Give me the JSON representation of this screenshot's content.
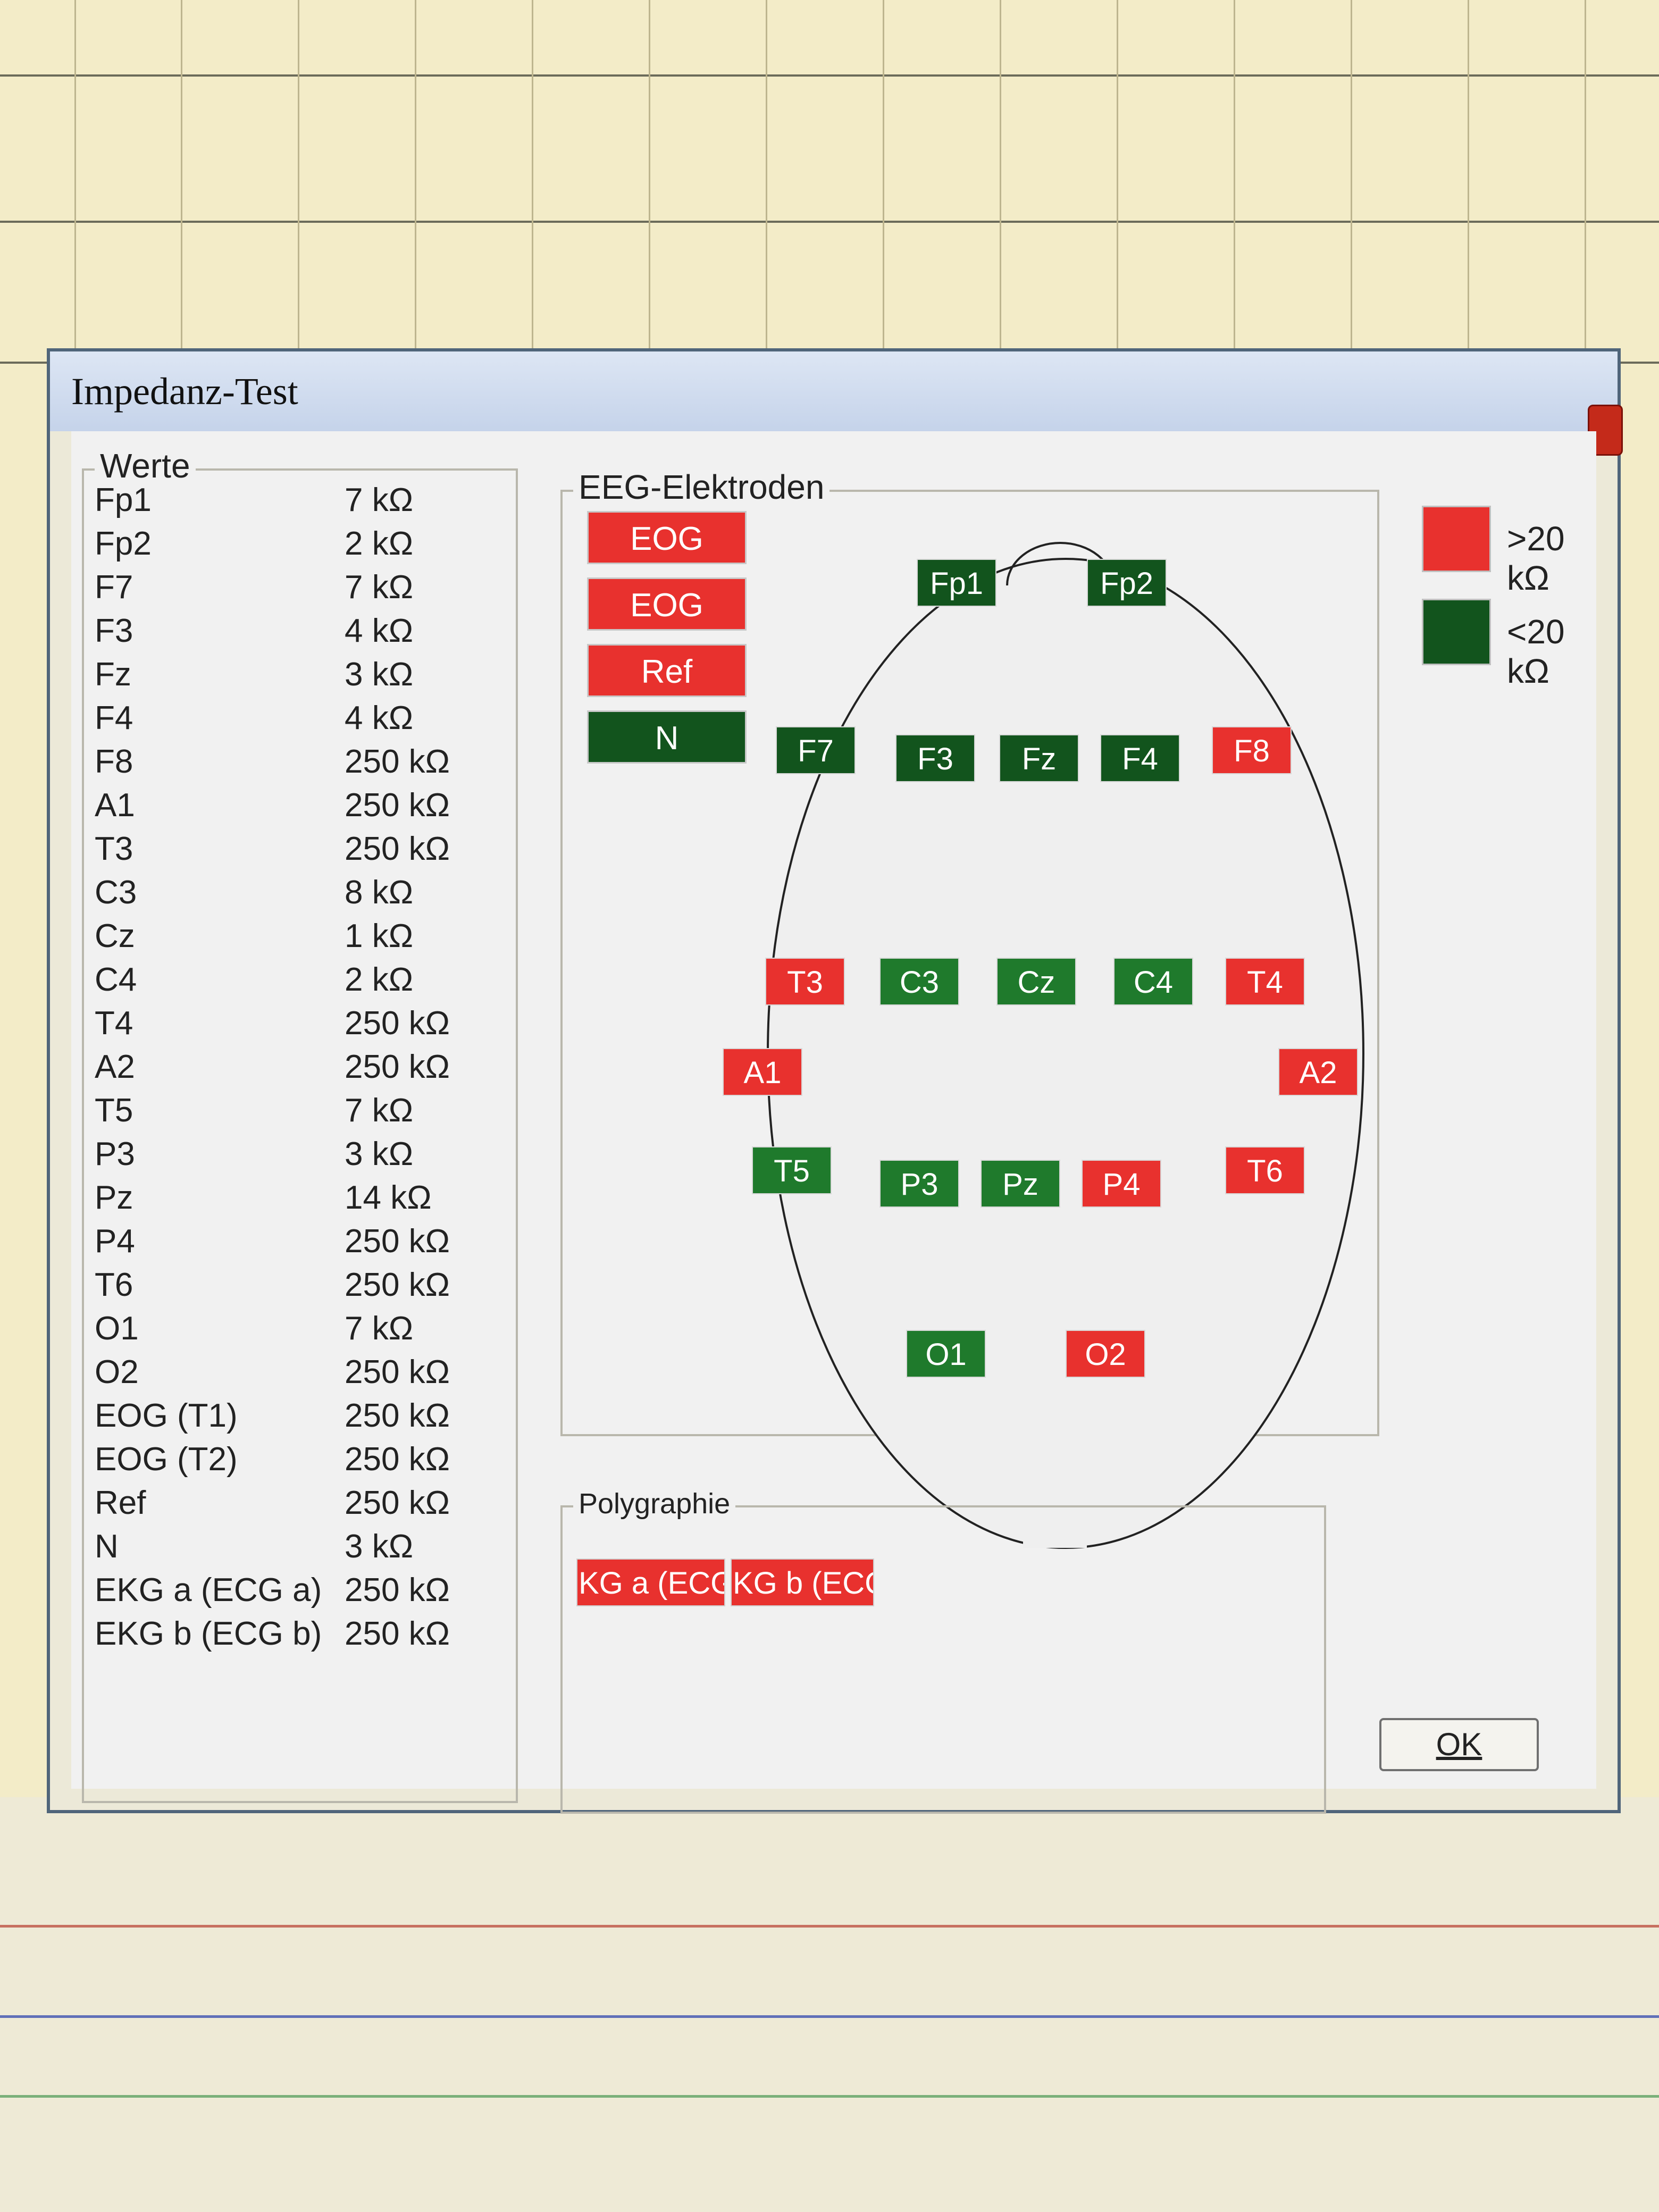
{
  "dialog": {
    "title": "Impedanz-Test",
    "ok_label": "OK"
  },
  "values_group": {
    "title": "Werte",
    "rows": [
      {
        "name": "Fp1",
        "value": "7 kΩ"
      },
      {
        "name": "Fp2",
        "value": "2 kΩ"
      },
      {
        "name": "F7",
        "value": "7 kΩ"
      },
      {
        "name": "F3",
        "value": "4 kΩ"
      },
      {
        "name": "Fz",
        "value": "3 kΩ"
      },
      {
        "name": "F4",
        "value": "4 kΩ"
      },
      {
        "name": "F8",
        "value": "250 kΩ"
      },
      {
        "name": "A1",
        "value": "250 kΩ"
      },
      {
        "name": "T3",
        "value": "250 kΩ"
      },
      {
        "name": "C3",
        "value": "8 kΩ"
      },
      {
        "name": "Cz",
        "value": "1 kΩ"
      },
      {
        "name": "C4",
        "value": "2 kΩ"
      },
      {
        "name": "T4",
        "value": "250 kΩ"
      },
      {
        "name": "A2",
        "value": "250 kΩ"
      },
      {
        "name": "T5",
        "value": "7 kΩ"
      },
      {
        "name": "P3",
        "value": "3 kΩ"
      },
      {
        "name": "Pz",
        "value": "14 kΩ"
      },
      {
        "name": "P4",
        "value": "250 kΩ"
      },
      {
        "name": "T6",
        "value": "250 kΩ"
      },
      {
        "name": "O1",
        "value": "7 kΩ"
      },
      {
        "name": "O2",
        "value": "250 kΩ"
      },
      {
        "name": "EOG (T1)",
        "value": "250 kΩ"
      },
      {
        "name": "EOG (T2)",
        "value": "250 kΩ"
      },
      {
        "name": "Ref",
        "value": "250 kΩ"
      },
      {
        "name": "N",
        "value": "3 kΩ"
      },
      {
        "name": "EKG a (ECG a)",
        "value": "250 kΩ"
      },
      {
        "name": "EKG b (ECG b)",
        "value": "250 kΩ"
      }
    ]
  },
  "eeg_group": {
    "title": "EEG-Elektroden",
    "side_buttons": [
      {
        "label": "EOG",
        "status": "red"
      },
      {
        "label": "EOG",
        "status": "red"
      },
      {
        "label": "Ref",
        "status": "red"
      },
      {
        "label": "N",
        "status": "dgreen"
      }
    ],
    "electrodes": {
      "Fp1": {
        "label": "Fp1",
        "status": "dgreen"
      },
      "Fp2": {
        "label": "Fp2",
        "status": "dgreen"
      },
      "F7": {
        "label": "F7",
        "status": "dgreen"
      },
      "F3": {
        "label": "F3",
        "status": "dgreen"
      },
      "Fz": {
        "label": "Fz",
        "status": "dgreen"
      },
      "F4": {
        "label": "F4",
        "status": "dgreen"
      },
      "F8": {
        "label": "F8",
        "status": "red"
      },
      "T3": {
        "label": "T3",
        "status": "red"
      },
      "C3": {
        "label": "C3",
        "status": "green"
      },
      "Cz": {
        "label": "Cz",
        "status": "green"
      },
      "C4": {
        "label": "C4",
        "status": "green"
      },
      "T4": {
        "label": "T4",
        "status": "red"
      },
      "A1": {
        "label": "A1",
        "status": "red"
      },
      "A2": {
        "label": "A2",
        "status": "red"
      },
      "T5": {
        "label": "T5",
        "status": "green"
      },
      "P3": {
        "label": "P3",
        "status": "green"
      },
      "Pz": {
        "label": "Pz",
        "status": "green"
      },
      "P4": {
        "label": "P4",
        "status": "red"
      },
      "T6": {
        "label": "T6",
        "status": "red"
      },
      "O1": {
        "label": "O1",
        "status": "green"
      },
      "O2": {
        "label": "O2",
        "status": "red"
      }
    }
  },
  "legend": {
    "high": {
      "label": ">20 kΩ",
      "color": "#e8312e"
    },
    "low": {
      "label": "<20 kΩ",
      "color": "#12541d"
    }
  },
  "poly_group": {
    "title": "Polygraphie",
    "buttons": [
      {
        "label": "KG a (ECG"
      },
      {
        "label": "KG b (ECG"
      }
    ]
  }
}
